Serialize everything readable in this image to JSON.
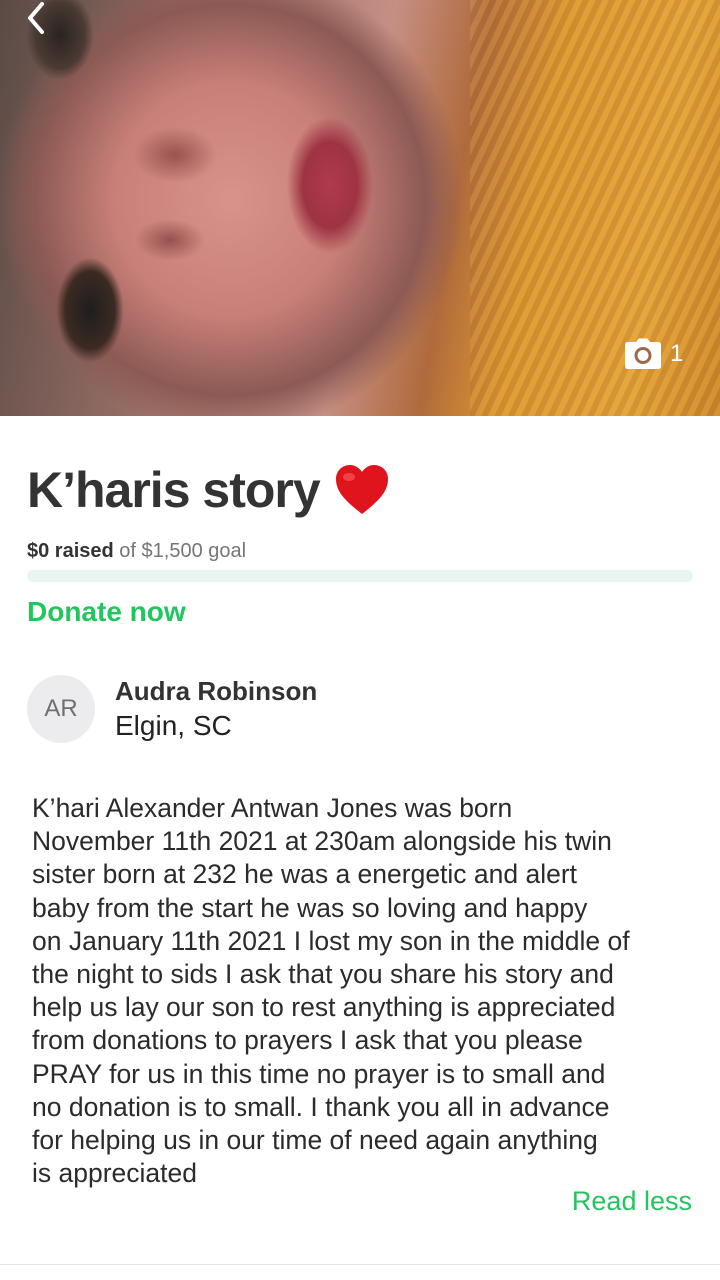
{
  "hero": {
    "photo_count": "1",
    "icons": {
      "back": "chevron-left-icon",
      "camera": "camera-icon"
    }
  },
  "campaign": {
    "title": "K’haris story",
    "title_emoji": "❤️",
    "raised_amount": "$0 raised",
    "goal_text": " of $1,500 goal",
    "progress_fraction": 0,
    "donate_label": "Donate now"
  },
  "organizer": {
    "initials": "AR",
    "name": "Audra Robinson",
    "location": "Elgin, SC"
  },
  "story": {
    "text": "K’hari Alexander Antwan Jones was born\nNovember 11th 2021 at 230am alongside his twin\nsister born at 232 he was a energetic and alert\nbaby from the start he was so loving and happy\non January 11th 2021 I lost my son in the middle of\nthe night to sids I ask that you share his story and\nhelp us lay our son to rest anything is appreciated\nfrom donations to prayers I ask that you please\nPRAY for us in this time no prayer is to small and\nno donation is to small. I thank you all in advance\nfor helping us in our time of need again anything\nis appreciated",
    "read_less_label": "Read less"
  },
  "colors": {
    "accent_green": "#22c55e",
    "progress_track": "#e6f7f0",
    "text_dark": "#333333",
    "text_muted": "#767676",
    "avatar_bg": "#ececef"
  }
}
